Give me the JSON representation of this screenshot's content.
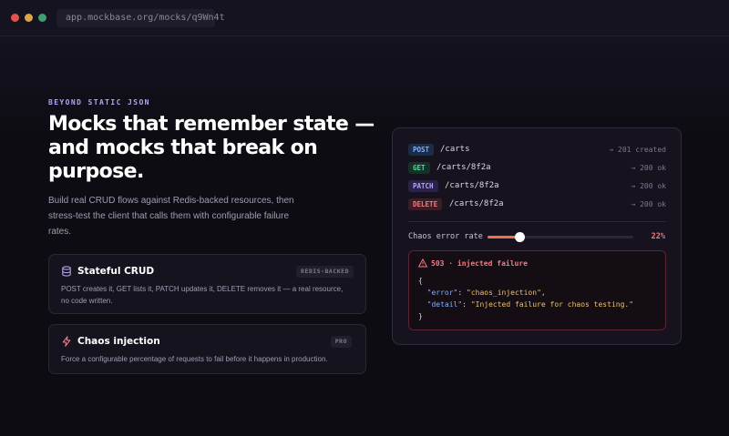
{
  "browser": {
    "url": "app.mockbase.org/mocks/q9Wn4t"
  },
  "hero": {
    "eyebrow": "BEYOND STATIC JSON",
    "headline_line1": "Mocks that remember state —",
    "headline_line2": "and mocks that break on",
    "headline_line3": "purpose.",
    "subtitle": "Build real CRUD flows against Redis-backed resources, then stress-test the client that calls them with configurable failure rates."
  },
  "features": [
    {
      "icon": "database-icon",
      "title": "Stateful CRUD",
      "badge": "REDIS-BACKED",
      "description": "POST creates it, GET lists it, PATCH updates it, DELETE removes it — a real resource, no code written."
    },
    {
      "icon": "lightning-icon",
      "title": "Chaos injection",
      "badge": "PRO",
      "description": "Force a configurable percentage of requests to fail before it happens in production."
    }
  ],
  "demo": {
    "requests": [
      {
        "method": "POST",
        "path": "/carts",
        "response": "→ 201 created"
      },
      {
        "method": "GET",
        "path": "/carts/8f2a",
        "response": "→ 200 ok"
      },
      {
        "method": "PATCH",
        "path": "/carts/8f2a",
        "response": "→ 200 ok"
      },
      {
        "method": "DELETE",
        "path": "/carts/8f2a",
        "response": "→ 200 ok"
      }
    ],
    "chaos_label": "Chaos error rate",
    "chaos_value": "22%",
    "chaos_fraction": 0.22,
    "error": {
      "title": "503 · injected failure",
      "open_brace": "{",
      "key_error": "\"error\"",
      "val_error": "\"chaos_injection\"",
      "key_detail": "\"detail\"",
      "val_detail": "\"Injected failure for chaos testing.\"",
      "close_brace": "}"
    }
  },
  "colors": {
    "accent": "#b9a2f7",
    "danger": "#f47b86",
    "slider": "#ef6f54"
  }
}
